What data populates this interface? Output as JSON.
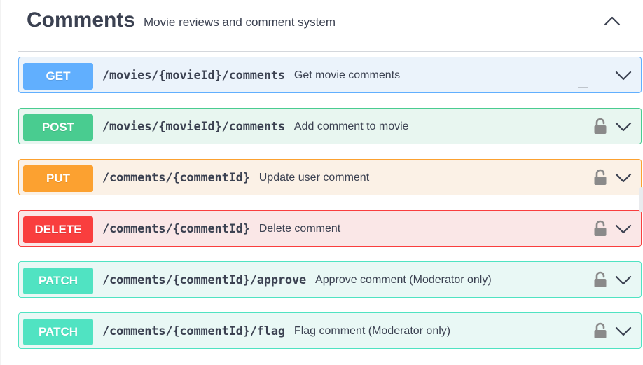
{
  "tag": {
    "title": "Comments",
    "description": "Movie reviews and comment system",
    "collapse_icon": "chevron-up-icon"
  },
  "operations": [
    {
      "method": "GET",
      "path": "/movies/{movieId}/comments",
      "summary": "Get movie comments",
      "locked": false,
      "colors": {
        "badge": "#61affe",
        "bg": "#ebf3fb",
        "border": "#61affe"
      }
    },
    {
      "method": "POST",
      "path": "/movies/{movieId}/comments",
      "summary": "Add comment to movie",
      "locked": true,
      "colors": {
        "badge": "#49cc90",
        "bg": "#e8f6f0",
        "border": "#49cc90"
      }
    },
    {
      "method": "PUT",
      "path": "/comments/{commentId}",
      "summary": "Update user comment",
      "locked": true,
      "colors": {
        "badge": "#fca130",
        "bg": "#fbf1e6",
        "border": "#fca130"
      }
    },
    {
      "method": "DELETE",
      "path": "/comments/{commentId}",
      "summary": "Delete comment",
      "locked": true,
      "colors": {
        "badge": "#f93e3e",
        "bg": "#fae7e7",
        "border": "#f93e3e"
      }
    },
    {
      "method": "PATCH",
      "path": "/comments/{commentId}/approve",
      "summary": "Approve comment (Moderator only)",
      "locked": true,
      "colors": {
        "badge": "#50e3c2",
        "bg": "#e9f8f5",
        "border": "#50e3c2"
      }
    },
    {
      "method": "PATCH",
      "path": "/comments/{commentId}/flag",
      "summary": "Flag comment (Moderator only)",
      "locked": true,
      "colors": {
        "badge": "#50e3c2",
        "bg": "#e9f8f5",
        "border": "#50e3c2"
      }
    }
  ],
  "icons": {
    "lock": "lock-icon",
    "expand": "chevron-down-icon"
  }
}
